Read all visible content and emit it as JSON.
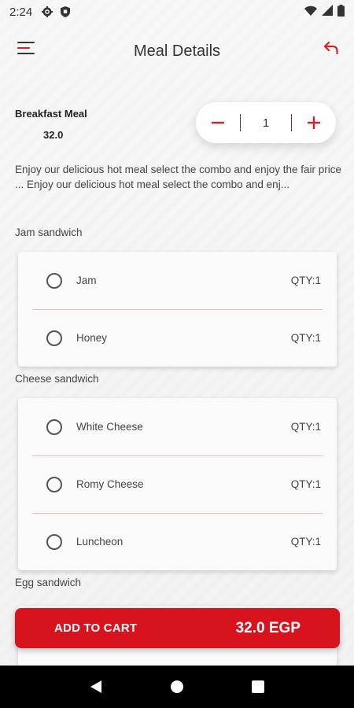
{
  "status_bar": {
    "time": "2:24"
  },
  "header": {
    "title": "Meal Details"
  },
  "meal": {
    "name": "Breakfast Meal",
    "price": "32.0"
  },
  "quantity": {
    "value": "1",
    "minus": "−",
    "plus": "+"
  },
  "description": "Enjoy our delicious hot meal select the combo and enjoy the fair price ... Enjoy our delicious hot meal select the combo and enj...",
  "groups": [
    {
      "title": "Jam sandwich",
      "options": [
        {
          "label": "Jam",
          "qty": "QTY:1"
        },
        {
          "label": "Honey",
          "qty": "QTY:1"
        }
      ]
    },
    {
      "title": "Cheese sandwich",
      "options": [
        {
          "label": "White Cheese",
          "qty": "QTY:1"
        },
        {
          "label": "Romy Cheese",
          "qty": "QTY:1"
        },
        {
          "label": "Luncheon",
          "qty": "QTY:1"
        }
      ]
    },
    {
      "title": "Egg sandwich",
      "options": []
    }
  ],
  "cart": {
    "label": "ADD TO CART",
    "total": "32.0 EGP"
  },
  "colors": {
    "accent": "#d7141e",
    "divider": "#f2b8bb"
  },
  "icons": {
    "menu": "menu-icon",
    "back": "back-arrow-icon",
    "settings": "gear-icon",
    "shield": "shield-icon",
    "wifi": "wifi-icon",
    "signal": "signal-icon",
    "battery": "battery-icon"
  }
}
